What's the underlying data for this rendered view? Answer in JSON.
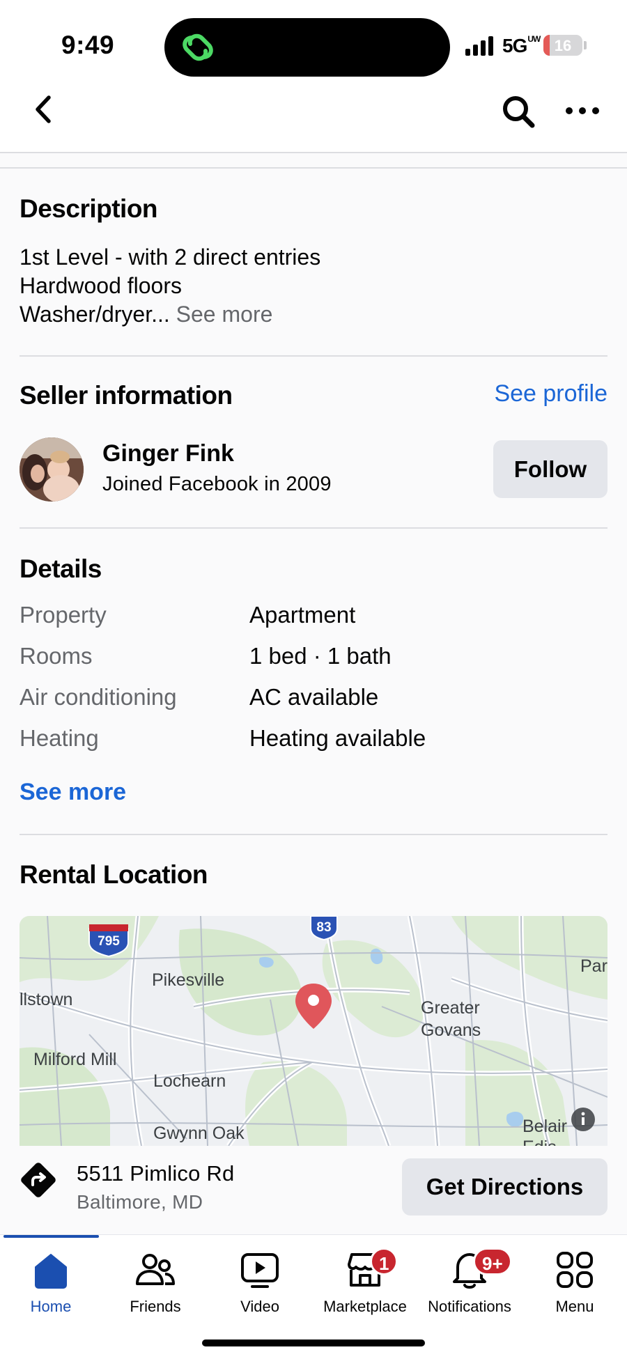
{
  "status_bar": {
    "time": "9:49",
    "network": "5G",
    "network_sub": "UW",
    "battery": "16",
    "battery_level": 0.16
  },
  "nav": {
    "back_icon": "chevron-left-icon",
    "search_icon": "search-icon",
    "more_icon": "more-horizontal-icon"
  },
  "description": {
    "heading": "Description",
    "lines": [
      "1st Level - with 2 direct entries",
      "Hardwood floors",
      "Washer/dryer..."
    ],
    "see_more": "See more"
  },
  "seller": {
    "heading": "Seller information",
    "see_profile": "See profile",
    "name": "Ginger Fink",
    "joined": "Joined Facebook in 2009",
    "follow": "Follow"
  },
  "details": {
    "heading": "Details",
    "rows": [
      {
        "label": "Property",
        "value": "Apartment"
      },
      {
        "label": "Rooms",
        "value": "1 bed · 1 bath"
      },
      {
        "label": "Air conditioning",
        "value": "AC available"
      },
      {
        "label": "Heating",
        "value": "Heating available"
      }
    ],
    "see_more": "See more"
  },
  "location": {
    "heading": "Rental Location",
    "map_labels": {
      "pikesville": "Pikesville",
      "owings": "llstown",
      "milford": "Milford Mill",
      "lochearn": "Lochearn",
      "gwynn": "Gwynn Oak",
      "greater": "Greater",
      "govans": "Govans",
      "par": "Par",
      "belair": "Belair",
      "edison": "Edis",
      "i795": "795",
      "i83": "83"
    },
    "street": "5511 Pimlico Rd",
    "city": "Baltimore, MD",
    "get_directions": "Get Directions"
  },
  "tabs": [
    {
      "label": "Home",
      "icon": "home-icon"
    },
    {
      "label": "Friends",
      "icon": "friends-icon"
    },
    {
      "label": "Video",
      "icon": "video-icon"
    },
    {
      "label": "Marketplace",
      "icon": "marketplace-icon",
      "badge": "1"
    },
    {
      "label": "Notifications",
      "icon": "bell-icon",
      "badge": "9+"
    },
    {
      "label": "Menu",
      "icon": "menu-grid-icon"
    }
  ],
  "colors": {
    "accent_blue": "#1b66d6",
    "badge_red": "#c8262f",
    "pin_red": "#e0565b"
  }
}
